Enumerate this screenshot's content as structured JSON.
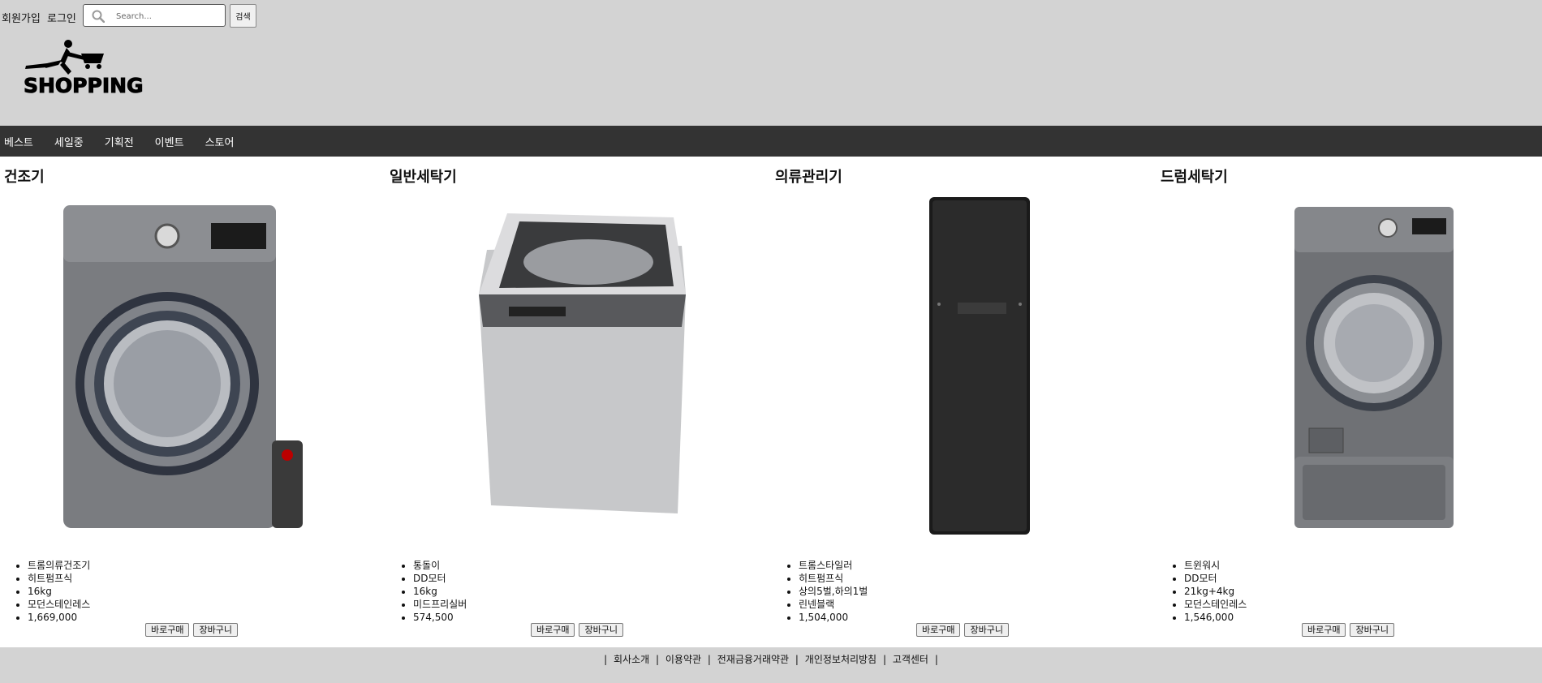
{
  "header": {
    "signup_label": "회원가입",
    "login_label": "로그인",
    "search_placeholder": "Search...",
    "search_button": "검색",
    "logo_text": "SHOPPING"
  },
  "nav": [
    "베스트",
    "세일중",
    "기획전",
    "이벤트",
    "스토어"
  ],
  "products": [
    {
      "title": "건조기",
      "image": "dryer",
      "features": [
        "트롬의류건조기",
        "히트펌프식",
        "16kg",
        "모던스테인레스"
      ],
      "price": "1,669,000",
      "buy": "바로구매",
      "cart": "장바구니"
    },
    {
      "title": "일반세탁기",
      "image": "top-load-washer",
      "features": [
        "통돌이",
        "DD모터",
        "16kg",
        "미드프리실버"
      ],
      "price": "574,500",
      "buy": "바로구매",
      "cart": "장바구니"
    },
    {
      "title": "의류관리기",
      "image": "styler",
      "features": [
        "트롬스타일러",
        "히트펌프식",
        "상의5벌,하의1벌",
        "린넨블랙"
      ],
      "price": "1,504,000",
      "buy": "바로구매",
      "cart": "장바구니"
    },
    {
      "title": "드럼세탁기",
      "image": "twin-wash",
      "features": [
        "트윈워시",
        "DD모터",
        "21kg+4kg",
        "모던스테인레스"
      ],
      "price": "1,546,000",
      "buy": "바로구매",
      "cart": "장바구니"
    }
  ],
  "footer": [
    "회사소개",
    "이용약관",
    "전재금융거래약관",
    "개인정보처리방침",
    "고객센터"
  ]
}
